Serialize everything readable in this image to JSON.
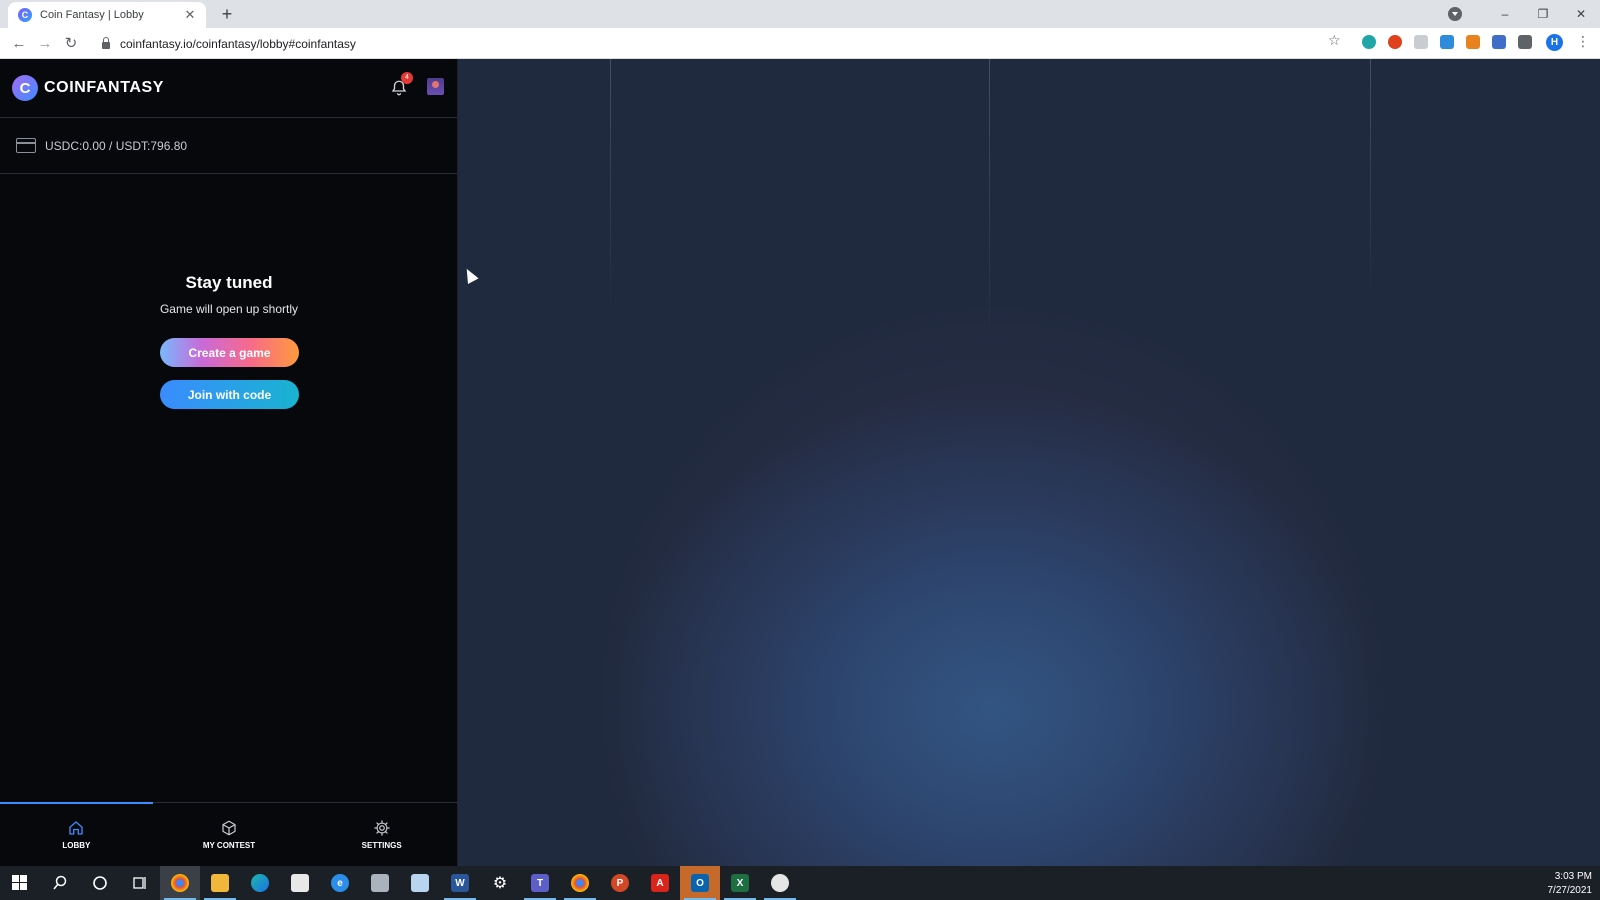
{
  "browser": {
    "tab_title": "Coin Fantasy | Lobby",
    "tab_favicon_letter": "C",
    "new_tab_symbol": "+",
    "url": "coinfantasy.io/coinfantasy/lobby#coinfantasy",
    "profile_initial": "H",
    "window_controls": [
      "–",
      "❐",
      "✕"
    ]
  },
  "app": {
    "brand": "COINFANTASY",
    "logo_letter": "C",
    "notification_count": "4",
    "balance": "USDC:0.00 / USDT:796.80",
    "heading": "Stay tuned",
    "subheading": "Game will open up shortly",
    "create_button": "Create a game",
    "join_button": "Join with code",
    "nav": [
      {
        "label": "LOBBY",
        "icon": "home-icon",
        "active": true
      },
      {
        "label": "MY CONTEST",
        "icon": "cube-icon",
        "active": false
      },
      {
        "label": "SETTINGS",
        "icon": "gear-icon",
        "active": false
      }
    ]
  },
  "taskbar": {
    "time": "3:03 PM",
    "date": "7/27/2021"
  },
  "colors": {
    "sidebar_bg": "#06080c",
    "accent_blue": "#3b8cff",
    "badge_red": "#e53935"
  }
}
